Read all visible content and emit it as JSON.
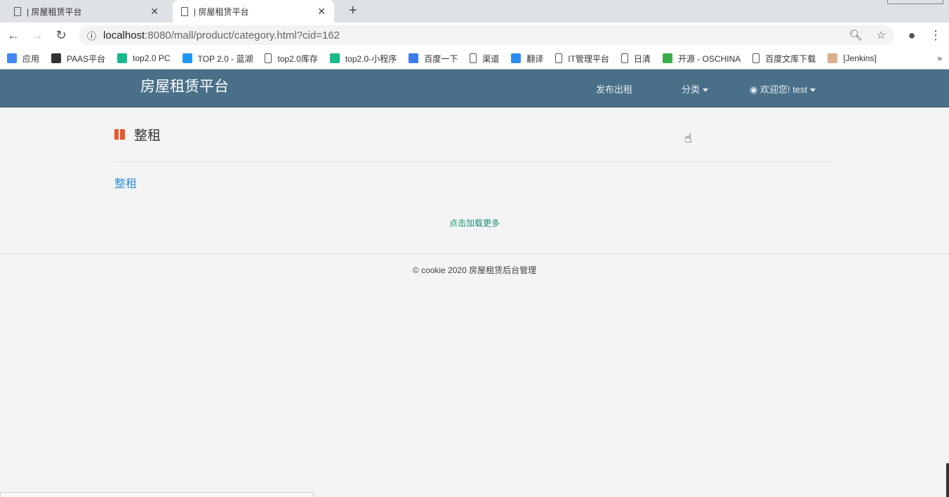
{
  "browser": {
    "tabs": [
      {
        "title": "| 房屋租赁平台",
        "active": false
      },
      {
        "title": "| 房屋租赁平台",
        "active": true
      }
    ],
    "url_host": "localhost",
    "url_path": ":8080/mall/product/category.html?cid=162",
    "bookmarks": [
      {
        "label": "应用",
        "icon": "apps-grid-icon",
        "color": "#4285f4"
      },
      {
        "label": "PAAS平台",
        "icon": "panda-icon",
        "color": "#333333"
      },
      {
        "label": "top2.0 PC",
        "icon": "play-icon",
        "color": "#19b98a"
      },
      {
        "label": "TOP 2.0 - 蓝湖",
        "icon": "lanhu-icon",
        "color": "#2196f3"
      },
      {
        "label": "top2.0库存",
        "icon": "page-icon",
        "color": "#ffffff"
      },
      {
        "label": "top2.0-小程序",
        "icon": "play-icon",
        "color": "#19b98a"
      },
      {
        "label": "百度一下",
        "icon": "baidu-paw-icon",
        "color": "#3b7bea"
      },
      {
        "label": "渠道",
        "icon": "page-icon",
        "color": "#ffffff"
      },
      {
        "label": "翻译",
        "icon": "translate-icon",
        "color": "#2b8cf0"
      },
      {
        "label": "IT管理平台",
        "icon": "page-icon",
        "color": "#ffffff"
      },
      {
        "label": "日清",
        "icon": "page-icon",
        "color": "#ffffff"
      },
      {
        "label": "开源 - OSCHINA",
        "icon": "oschina-icon",
        "color": "#3bab4a"
      },
      {
        "label": "百度文库下载",
        "icon": "page-icon",
        "color": "#ffffff"
      },
      {
        "label": "[Jenkins]",
        "icon": "jenkins-icon",
        "color": "#d8b08c"
      }
    ],
    "more": "»"
  },
  "nav": {
    "brand": "房屋租赁平台",
    "publish": "发布出租",
    "category": "分类",
    "user": "欢迎您! test"
  },
  "main": {
    "heading": "整租",
    "links": [
      "整租"
    ],
    "load_more": "点击加载更多"
  },
  "footer": {
    "text": "© cookie 2020  房屋租赁后台管理"
  },
  "colors": {
    "navbar": "#4a7089",
    "link": "#2f8fd3",
    "load_more": "#1a8f7a",
    "gift": "#e8572a"
  }
}
